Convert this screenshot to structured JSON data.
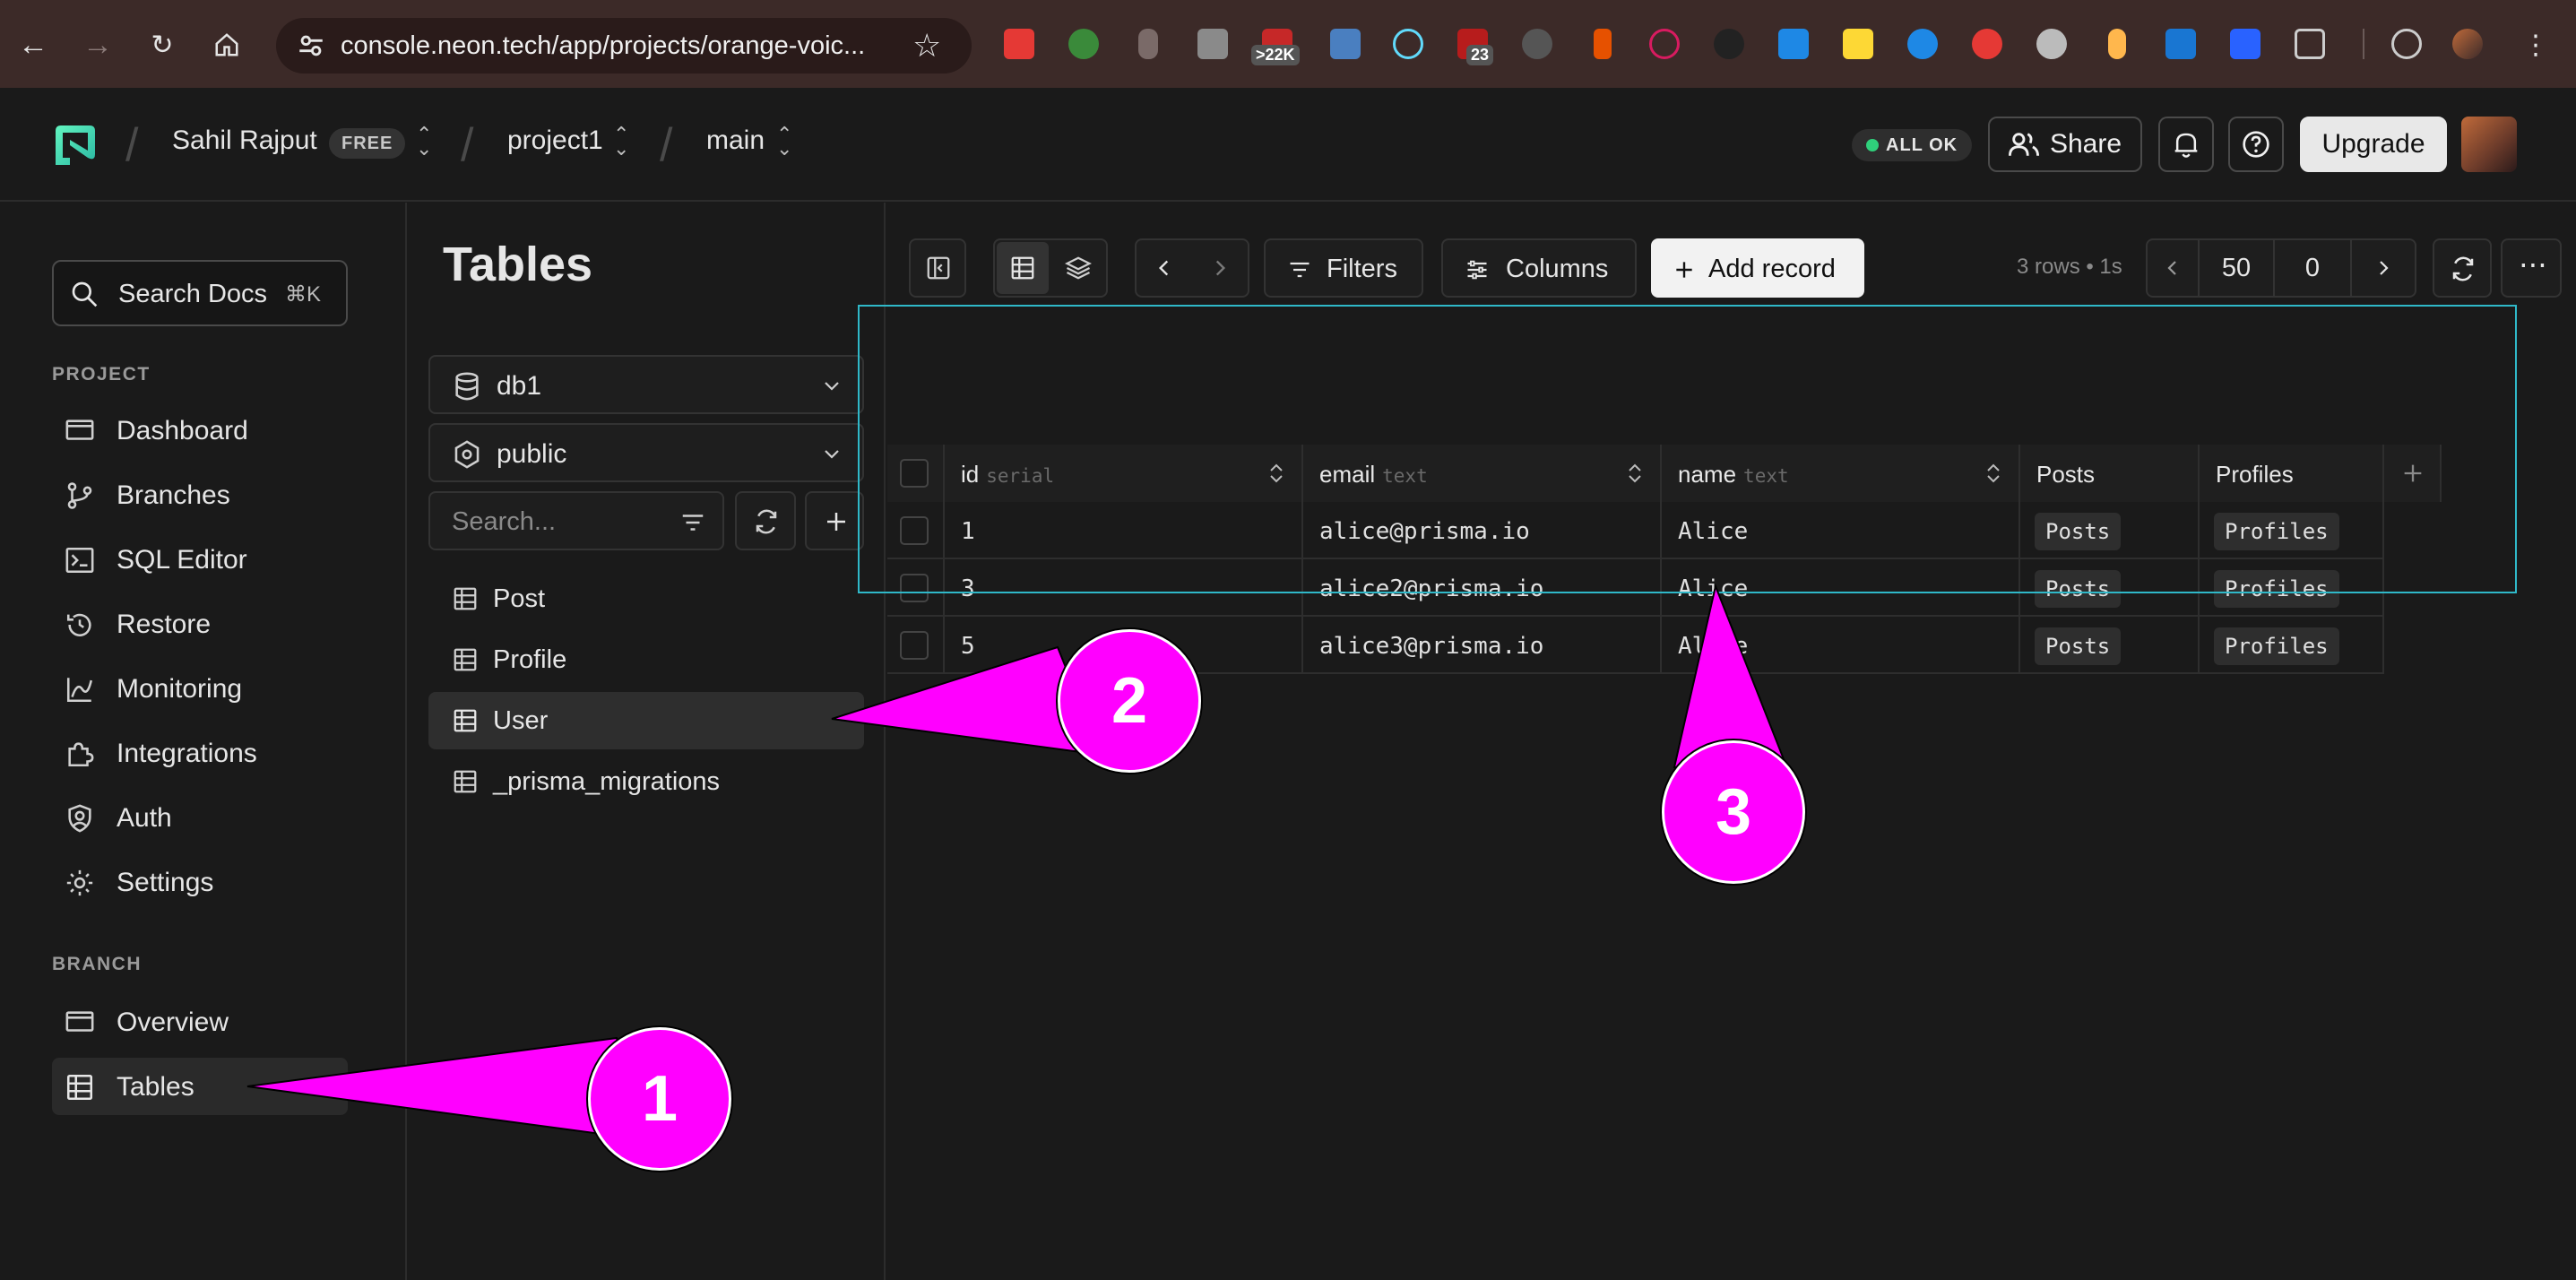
{
  "browser": {
    "url": "console.neon.tech/app/projects/orange-voic...",
    "badges": [
      ">22K",
      "23"
    ]
  },
  "header": {
    "user": "Sahil Rajput",
    "plan_badge": "FREE",
    "project": "project1",
    "branch": "main",
    "status": "ALL OK",
    "share": "Share",
    "upgrade": "Upgrade"
  },
  "sidebar": {
    "search_label": "Search Docs",
    "search_kbd": "⌘K",
    "project_section": "PROJECT",
    "project_items": [
      {
        "label": "Dashboard",
        "icon": "monitor-icon"
      },
      {
        "label": "Branches",
        "icon": "branch-icon"
      },
      {
        "label": "SQL Editor",
        "icon": "terminal-icon"
      },
      {
        "label": "Restore",
        "icon": "restore-icon"
      },
      {
        "label": "Monitoring",
        "icon": "chart-icon"
      },
      {
        "label": "Integrations",
        "icon": "puzzle-icon"
      },
      {
        "label": "Auth",
        "icon": "user-shield-icon"
      },
      {
        "label": "Settings",
        "icon": "gear-icon"
      }
    ],
    "branch_section": "BRANCH",
    "branch_items": [
      {
        "label": "Overview",
        "icon": "monitor-icon"
      },
      {
        "label": "Tables",
        "icon": "table-icon"
      }
    ]
  },
  "tables_panel": {
    "title": "Tables",
    "database": "db1",
    "schema": "public",
    "search_placeholder": "Search...",
    "tables": [
      "Post",
      "Profile",
      "User",
      "_prisma_migrations"
    ]
  },
  "toolbar": {
    "filters": "Filters",
    "columns": "Columns",
    "add_record": "Add record",
    "rows_info": "3 rows • 1s",
    "limit": "50",
    "offset": "0"
  },
  "grid": {
    "columns": [
      {
        "name": "id",
        "type": "serial"
      },
      {
        "name": "email",
        "type": "text"
      },
      {
        "name": "name",
        "type": "text"
      },
      {
        "name": "Posts",
        "type": ""
      },
      {
        "name": "Profiles",
        "type": ""
      }
    ],
    "rows": [
      {
        "id": "1",
        "email": "alice@prisma.io",
        "name": "Alice",
        "posts": "Posts",
        "profiles": "Profiles"
      },
      {
        "id": "3",
        "email": "alice2@prisma.io",
        "name": "Alice",
        "posts": "Posts",
        "profiles": "Profiles"
      },
      {
        "id": "5",
        "email": "alice3@prisma.io",
        "name": "Alice",
        "posts": "Posts",
        "profiles": "Profiles"
      }
    ]
  },
  "annotations": [
    "1",
    "2",
    "3"
  ],
  "colors": {
    "accent": "#ff00ff",
    "selection": "#2fb8c8",
    "ok": "#2fd07b"
  }
}
